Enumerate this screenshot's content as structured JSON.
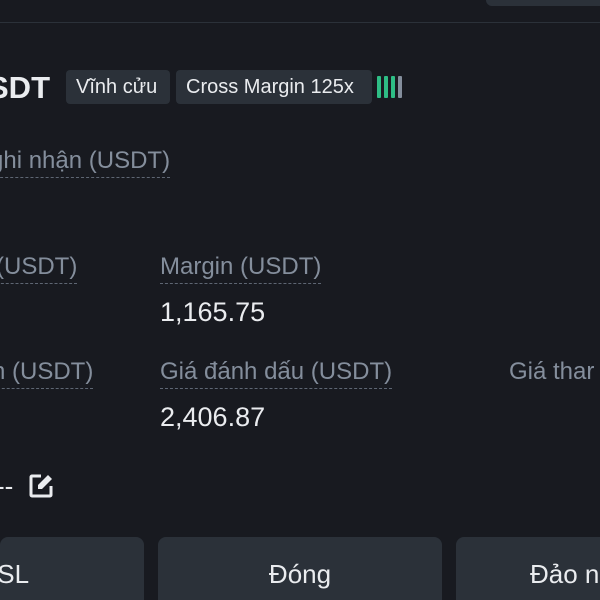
{
  "header": {
    "symbol": "SDT",
    "mode_tag": "Vĩnh cửu",
    "margin_tag": "Cross Margin 125x",
    "risk_bars_active": 3,
    "risk_bars_total": 4,
    "risk_color": "#2ebd85"
  },
  "pnl": {
    "label": "ghi nhận (USDT)"
  },
  "row1": {
    "left_label": "(USDT)",
    "margin_label": "Margin (USDT)",
    "margin_value": "1,165.75"
  },
  "row2": {
    "left_label": "n (USDT)",
    "mark_label": "Giá đánh dấu (USDT)",
    "mark_value": "2,406.87",
    "liq_label": "Giá thar"
  },
  "tpsl": {
    "value": "--",
    "edit_icon": "edit-icon"
  },
  "actions": {
    "tpsl_label": "/SL",
    "close_label": "Đóng",
    "reverse_label": "Đảo n"
  },
  "colors": {
    "background": "#181a20",
    "panel": "#2b3139",
    "text": "#eaecef",
    "muted": "#848e9c"
  }
}
